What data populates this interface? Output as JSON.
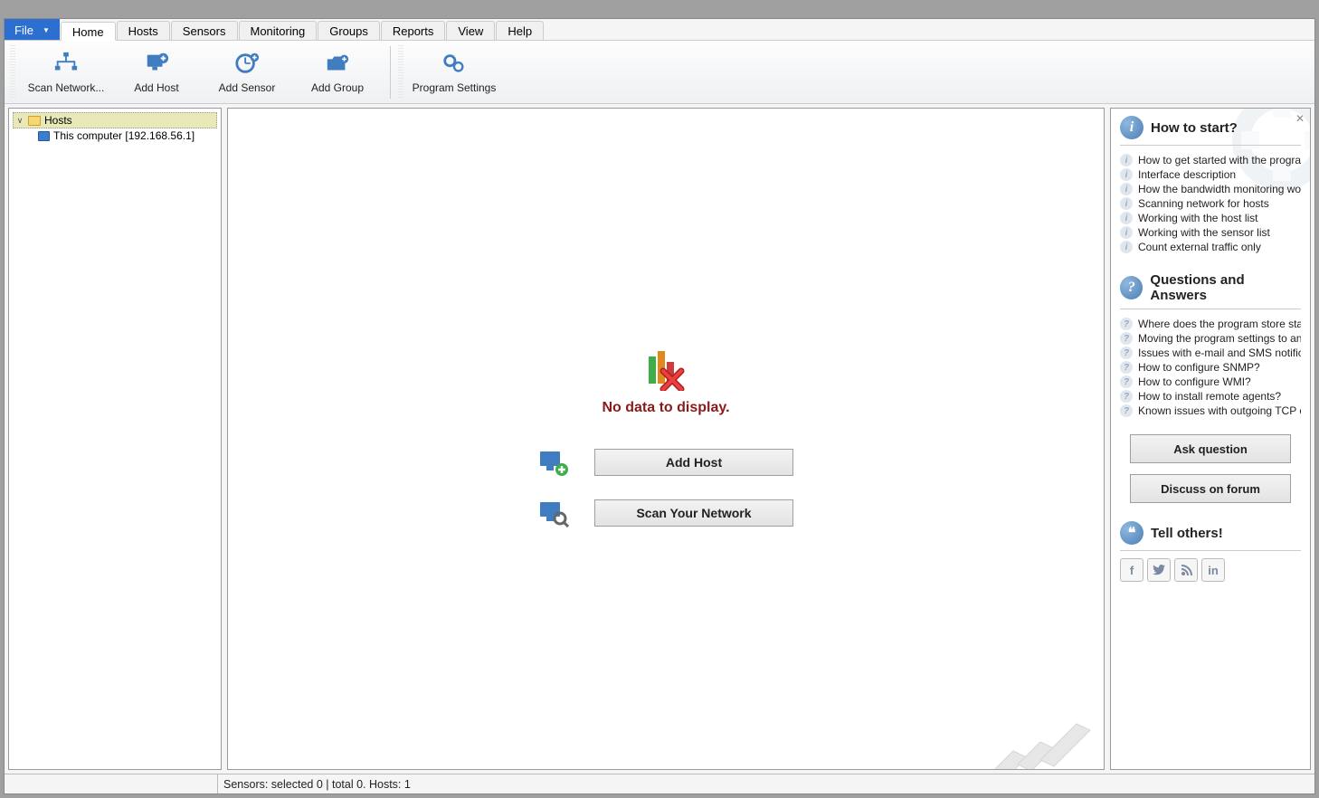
{
  "menu": {
    "file": "File",
    "tabs": [
      "Home",
      "Hosts",
      "Sensors",
      "Monitoring",
      "Groups",
      "Reports",
      "View",
      "Help"
    ],
    "active": "Home"
  },
  "ribbon": {
    "scan_network": "Scan Network...",
    "add_host": "Add Host",
    "add_sensor": "Add Sensor",
    "add_group": "Add Group",
    "program_settings": "Program Settings"
  },
  "tree": {
    "root": "Hosts",
    "children": [
      {
        "label": "This computer [192.168.56.1]"
      }
    ]
  },
  "main": {
    "no_data": "No data to display.",
    "add_host_btn": "Add Host",
    "scan_network_btn": "Scan Your Network"
  },
  "side": {
    "how_to_start": {
      "title": "How to start?",
      "items": [
        "How to get started with the program?",
        "Interface description",
        "How the bandwidth monitoring wor...",
        "Scanning network for hosts",
        "Working with the host list",
        "Working with the sensor list",
        "Count external traffic only"
      ]
    },
    "qa": {
      "title": "Questions and Answers",
      "items": [
        "Where does the program store stats, ...",
        "Moving the program settings to ano...",
        "Issues with e-mail and SMS notificati...",
        "How to configure SNMP?",
        "How to configure WMI?",
        "How to install remote agents?",
        "Known issues with outgoing TCP co..."
      ],
      "ask_btn": "Ask question",
      "forum_btn": "Discuss on forum"
    },
    "tell": {
      "title": "Tell others!"
    }
  },
  "status": {
    "text": "Sensors: selected 0 | total 0. Hosts: 1"
  }
}
